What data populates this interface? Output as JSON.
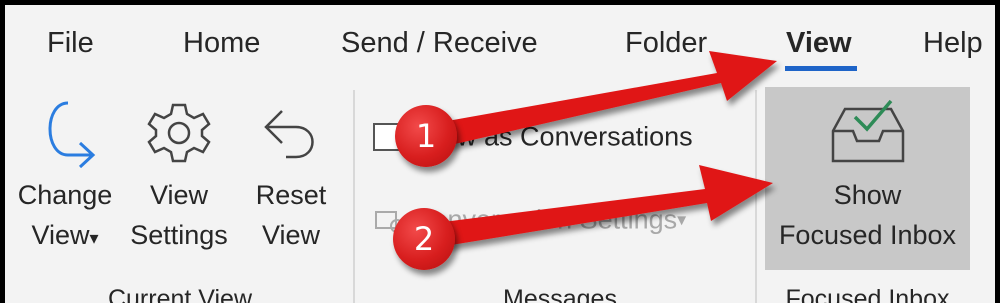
{
  "tabs": [
    "File",
    "Home",
    "Send / Receive",
    "Folder",
    "View",
    "Help"
  ],
  "active_tab": "View",
  "current_view": {
    "change_view": {
      "line1": "Change",
      "line2": "View",
      "caret": "▾"
    },
    "view_settings": {
      "line1": "View",
      "line2": "Settings"
    },
    "reset_view": {
      "line1": "Reset",
      "line2": "View"
    },
    "group_label": "Current View"
  },
  "messages": {
    "show_as_conversations": "Show as Conversations",
    "conversation_settings": "Conversation Settings",
    "conversation_settings_caret": "▾",
    "group_label": "Messages"
  },
  "focused_inbox": {
    "line1": "Show",
    "line2": "Focused Inbox",
    "group_label": "Focused Inbox"
  },
  "annotations": {
    "badge1": "1",
    "badge2": "2"
  },
  "colors": {
    "accent": "#1e64c8",
    "arrow": "#e01818",
    "check": "#2e8b57"
  }
}
